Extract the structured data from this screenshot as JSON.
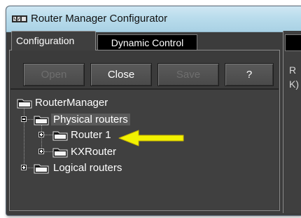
{
  "window": {
    "title": "Router Manager Configurator"
  },
  "tabs": [
    {
      "label": "Configuration",
      "active": true
    },
    {
      "label": "Dynamic Control",
      "active": false
    }
  ],
  "toolbar": {
    "open_label": "Open",
    "close_label": "Close",
    "save_label": "Save",
    "help_label": "?"
  },
  "tree": {
    "root": "RouterManager",
    "physical": "Physical routers",
    "router1": "Router 1",
    "kxrouter": "KXRouter",
    "logical": "Logical routers"
  },
  "right_pane": {
    "line1": "R",
    "line2": "K)"
  },
  "colors": {
    "window_bg": "#3c3c3c",
    "titlebar": "#b9dcec",
    "highlight_arrow": "#f2f200",
    "disabled_text": "#6e6e6e"
  },
  "icons": [
    "app-icon",
    "folder-icon",
    "expand-icon",
    "collapse-icon",
    "arrow-annotation"
  ]
}
